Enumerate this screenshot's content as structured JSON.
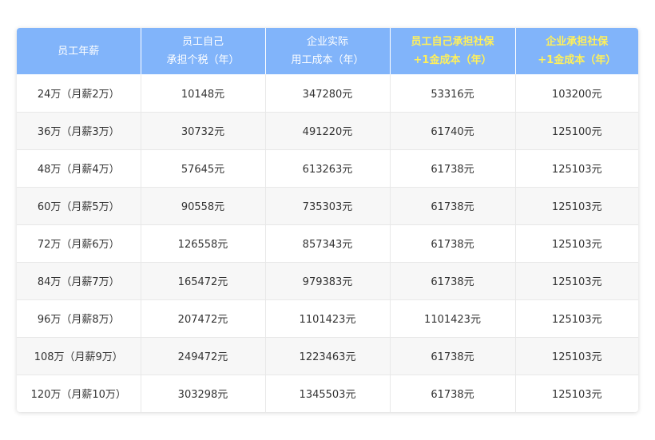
{
  "headers": [
    {
      "lines": [
        "员工年薪"
      ],
      "highlight": false
    },
    {
      "lines": [
        "员工自己",
        "承担个税（年）"
      ],
      "highlight": false
    },
    {
      "lines": [
        "企业实际",
        "用工成本（年）"
      ],
      "highlight": false
    },
    {
      "lines": [
        "员工自己承担社保",
        "+1金成本（年）"
      ],
      "highlight": true
    },
    {
      "lines": [
        "企业承担社保",
        "+1金成本（年）"
      ],
      "highlight": true
    }
  ],
  "rows": [
    [
      "24万（月薪2万）",
      "10148元",
      "347280元",
      "53316元",
      "103200元"
    ],
    [
      "36万（月薪3万）",
      "30732元",
      "491220元",
      "61740元",
      "125100元"
    ],
    [
      "48万（月薪4万）",
      "57645元",
      "613263元",
      "61738元",
      "125103元"
    ],
    [
      "60万（月薪5万）",
      "90558元",
      "735303元",
      "61738元",
      "125103元"
    ],
    [
      "72万（月薪6万）",
      "126558元",
      "857343元",
      "61738元",
      "125103元"
    ],
    [
      "84万（月薪7万）",
      "165472元",
      "979383元",
      "61738元",
      "125103元"
    ],
    [
      "96万（月薪8万）",
      "207472元",
      "1101423元",
      "1101423元",
      "125103元"
    ],
    [
      "108万（月薪9万）",
      "249472元",
      "1223463元",
      "61738元",
      "125103元"
    ],
    [
      "120万（月薪10万）",
      "303298元",
      "1345503元",
      "61738元",
      "125103元"
    ]
  ],
  "colors": {
    "header_bg": "#81b4fa",
    "header_text": "#ffffff",
    "header_highlight_text": "#fff05a",
    "alt_row_bg": "#f7f7f7"
  }
}
